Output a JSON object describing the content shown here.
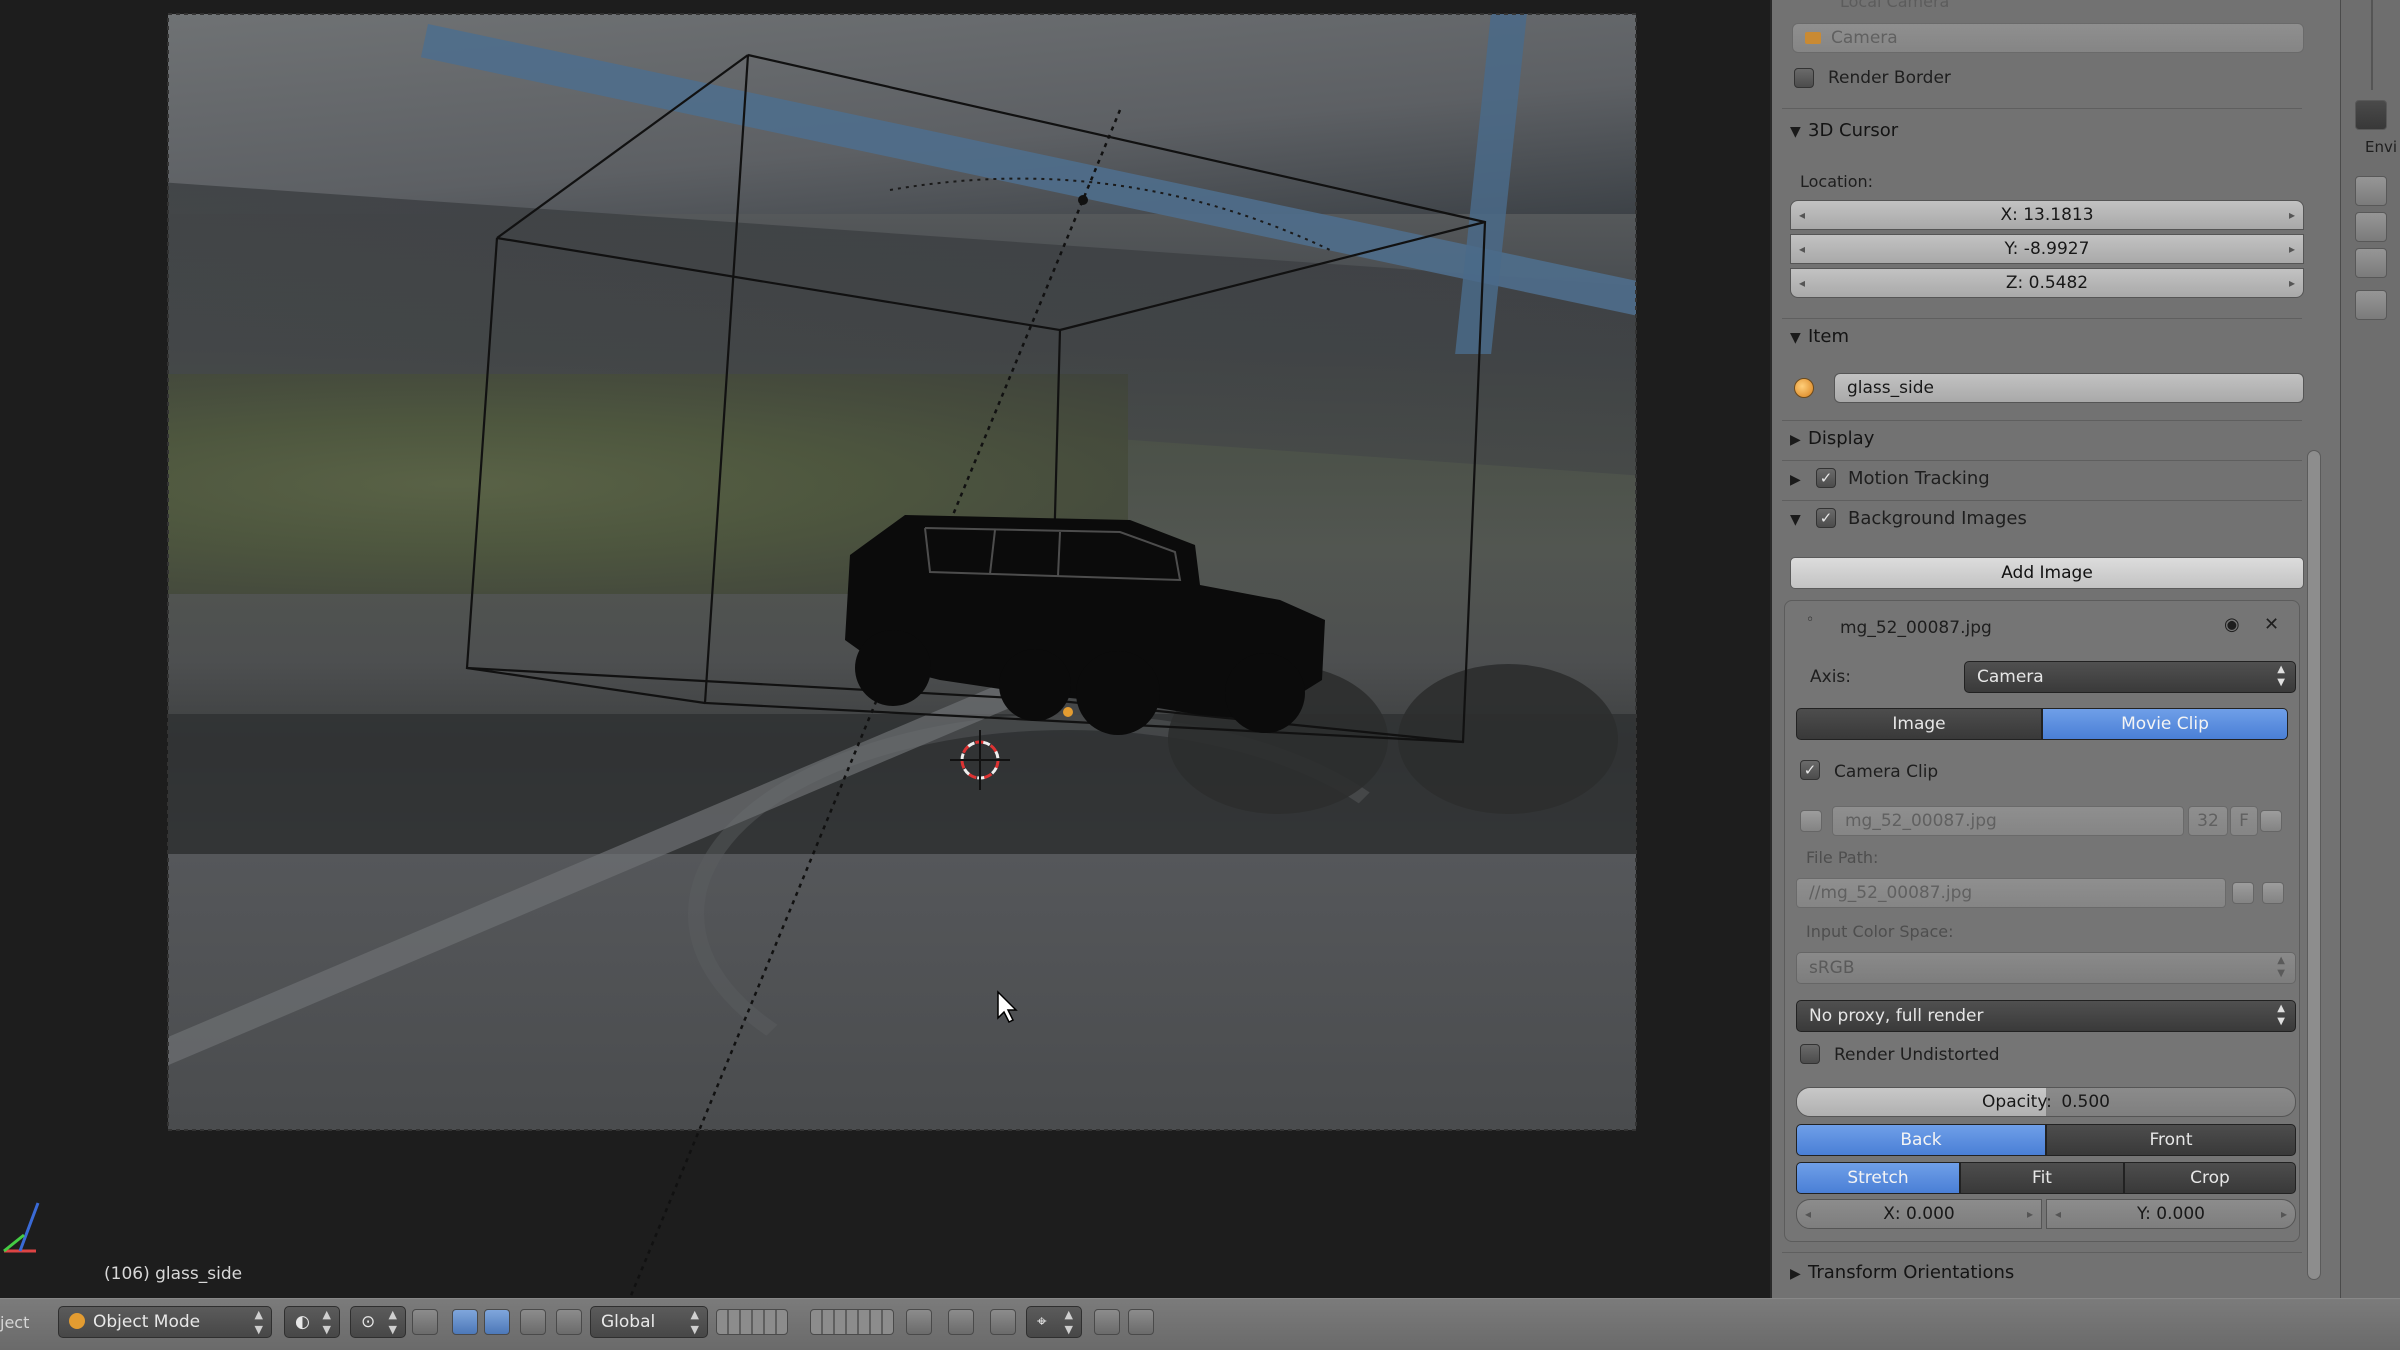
{
  "viewport": {
    "object_info": "(106) glass_side"
  },
  "header": {
    "menu_fragment": "ject",
    "mode": "Object Mode",
    "orientation": "Global"
  },
  "panel": {
    "faded_top_label": "Local Camera",
    "camera_field": "Camera",
    "render_border_label": "Render Border",
    "cursor_section": "3D Cursor",
    "location_label": "Location:",
    "cursor_x": "X: 13.1813",
    "cursor_y": "Y: -8.9927",
    "cursor_z": "Z: 0.5482",
    "item_section": "Item",
    "item_name": "glass_side",
    "display_section": "Display",
    "motion_tracking_section": "Motion Tracking",
    "background_images_section": "Background Images",
    "add_image_label": "Add Image",
    "bg_image": {
      "filename": "mg_52_00087.jpg",
      "axis_label": "Axis:",
      "axis_value": "Camera",
      "source_tabs": [
        "Image",
        "Movie Clip"
      ],
      "active_source": "Movie Clip",
      "camera_clip_label": "Camera Clip",
      "clip_field": "mg_52_00087.jpg",
      "clip_users": "32",
      "clip_fake": "F",
      "file_path_label": "File Path:",
      "file_path": "//mg_52_00087.jpg",
      "color_space_label": "Input Color Space:",
      "color_space_value": "sRGB",
      "proxy_value": "No proxy, full render",
      "render_undistorted_label": "Render Undistorted",
      "opacity_label": "Opacity:",
      "opacity_value": "0.500",
      "opacity_fraction": 0.5,
      "depth_buttons": [
        "Back",
        "Front"
      ],
      "active_depth": "Back",
      "frame_buttons": [
        "Stretch",
        "Fit",
        "Crop"
      ],
      "active_frame": "Stretch",
      "offset_x": "X: 0.000",
      "offset_y": "Y: 0.000"
    },
    "transform_orientations_section": "Transform Orientations"
  },
  "toolbar_right": {
    "label": "Envi"
  },
  "colors": {
    "accent_blue": "#4a7fd6",
    "panel_bg": "#727272",
    "object_orange": "#e39c31"
  }
}
